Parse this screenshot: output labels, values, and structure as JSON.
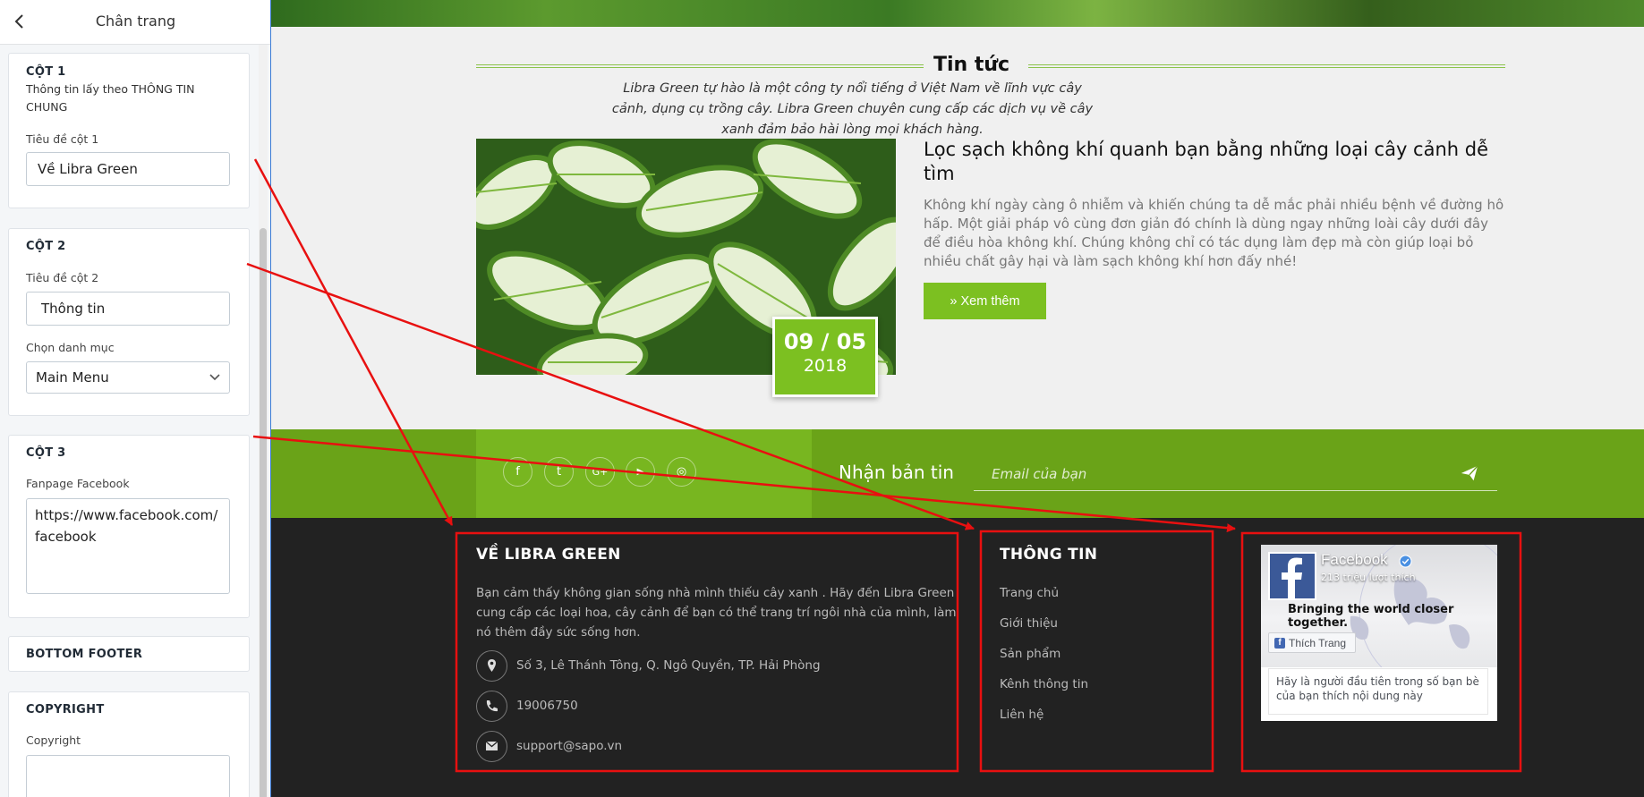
{
  "editor": {
    "title": "Chân trang",
    "col1": {
      "title": "CỘT 1",
      "note": "Thông tin lấy theo THÔNG TIN CHUNG",
      "field_label": "Tiêu đề cột 1",
      "field_value": "Về Libra Green"
    },
    "col2": {
      "title": "CỘT 2",
      "field_label": "Tiêu đề cột 2",
      "field_value": "Thông tin",
      "select_label": "Chọn danh mục",
      "select_value": "Main Menu"
    },
    "col3": {
      "title": "CỘT 3",
      "field_label": "Fanpage Facebook",
      "field_value": "https://www.facebook.com/facebook"
    },
    "bottom_footer": {
      "title": "BOTTOM FOOTER"
    },
    "copyright": {
      "title": "COPYRIGHT",
      "field_label": "Copyright",
      "field_value": ""
    }
  },
  "preview": {
    "news": {
      "title": "Tin tức",
      "description": "Libra Green tự hào là một công ty nổi tiếng ở Việt Nam về lĩnh vực cây cảnh, dụng cụ trồng cây. Libra Green chuyên cung cấp các dịch vụ về cây xanh đảm bảo hài lòng mọi khách hàng.",
      "article": {
        "title": "Lọc sạch không khí quanh bạn bằng những loại cây cảnh dễ tìm",
        "excerpt": "Không khí ngày càng ô nhiễm và khiến chúng ta dễ mắc phải nhiều bệnh về đường hô hấp. Một giải pháp vô cùng đơn giản đó chính là dùng ngay những loài cây dưới đây để điều hòa không khí. Chúng không chỉ có tác dụng làm đẹp mà còn giúp loại bỏ nhiều chất gây hại và làm sạch không khí hơn đấy nhé!",
        "date_day_month": "09 / 05",
        "date_year": "2018",
        "read_more": "» Xem thêm"
      }
    },
    "newsletter": {
      "label": "Nhận bản tin",
      "placeholder": "Email của bạn",
      "social": [
        "f",
        "t",
        "G+",
        "▶",
        "◎"
      ]
    },
    "footer": {
      "about": {
        "title": "VỀ LIBRA GREEN",
        "text": "Bạn cảm thấy không gian sống nhà mình thiếu cây xanh . Hãy đến Libra Green cung cấp các loại hoa, cây cảnh để bạn có thể trang trí ngôi nhà của mình, làm nó thêm đầy sức sống hơn.",
        "address": "Số 3, Lê Thánh Tông, Q. Ngô Quyền, TP. Hải Phòng",
        "phone": "19006750",
        "email": "support@sapo.vn"
      },
      "info": {
        "title": "THÔNG TIN",
        "links": [
          "Trang chủ",
          "Giới thiệu",
          "Sản phẩm",
          "Kênh thông tin",
          "Liên hệ"
        ]
      },
      "facebook": {
        "name": "Facebook",
        "likes": "213 triệu lượt thích",
        "slogan": "Bringing the world closer together.",
        "like_button": "Thích Trang",
        "friends_text": "Hãy là người đầu tiên trong số bạn bè của bạn thích nội dung này"
      }
    }
  },
  "colors": {
    "accent_green": "#7cc021",
    "band_green": "#6aa318",
    "footer_bg": "#222222",
    "annotation_red": "#e81010"
  }
}
